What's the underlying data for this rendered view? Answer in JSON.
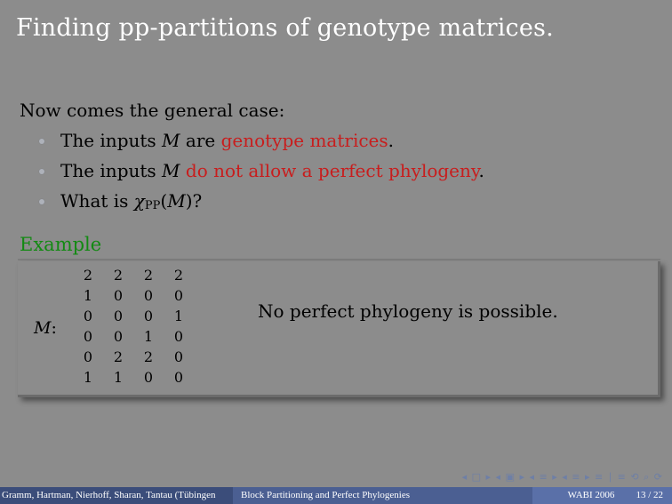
{
  "slide": {
    "title": "Finding pp-partitions of genotype matrices.",
    "intro": "Now comes the general case:",
    "bullets": {
      "b1": {
        "pre": "The inputs ",
        "var": "M",
        "mid": " are ",
        "red": "genotype matrices",
        "post": "."
      },
      "b2": {
        "pre": "The inputs ",
        "var": "M",
        "mid": " ",
        "red": "do not allow a perfect phylogeny",
        "post": "."
      },
      "b3": {
        "pre": "What is ",
        "chi": "χ",
        "sub": "PP",
        "open": "(",
        "var": "M",
        "close": ")?"
      }
    },
    "example": {
      "title": "Example",
      "label": "M",
      "colon": ":",
      "matrix": [
        [
          "2",
          "2",
          "2",
          "2"
        ],
        [
          "1",
          "0",
          "0",
          "0"
        ],
        [
          "0",
          "0",
          "0",
          "1"
        ],
        [
          "0",
          "0",
          "1",
          "0"
        ],
        [
          "0",
          "2",
          "2",
          "0"
        ],
        [
          "1",
          "1",
          "0",
          "0"
        ]
      ],
      "note": "No perfect phylogeny is possible."
    }
  },
  "footer": {
    "authors": "Gramm, Hartman, Nierhoff, Sharan, Tantau  (Tübingen",
    "talk_title": "Block Partitioning and Perfect Phylogenies",
    "venue": "WABI 2006",
    "page": "13 / 22"
  },
  "nav": {
    "symbols": "◂ □ ▸ ◂ ▣ ▸ ◂ ≡ ▸ ◂ ≡ ▸   ≡ ∣ ≡   ⟲ ⌕ ⟳"
  },
  "colors": {
    "background": "#8c8c8c",
    "title": "#ffffff",
    "highlight_red": "#c81d1d",
    "example_green": "#128a12",
    "footer_dark": "#3b4d7a",
    "footer_mid": "#4b5f92",
    "footer_light": "#5a70a8"
  }
}
